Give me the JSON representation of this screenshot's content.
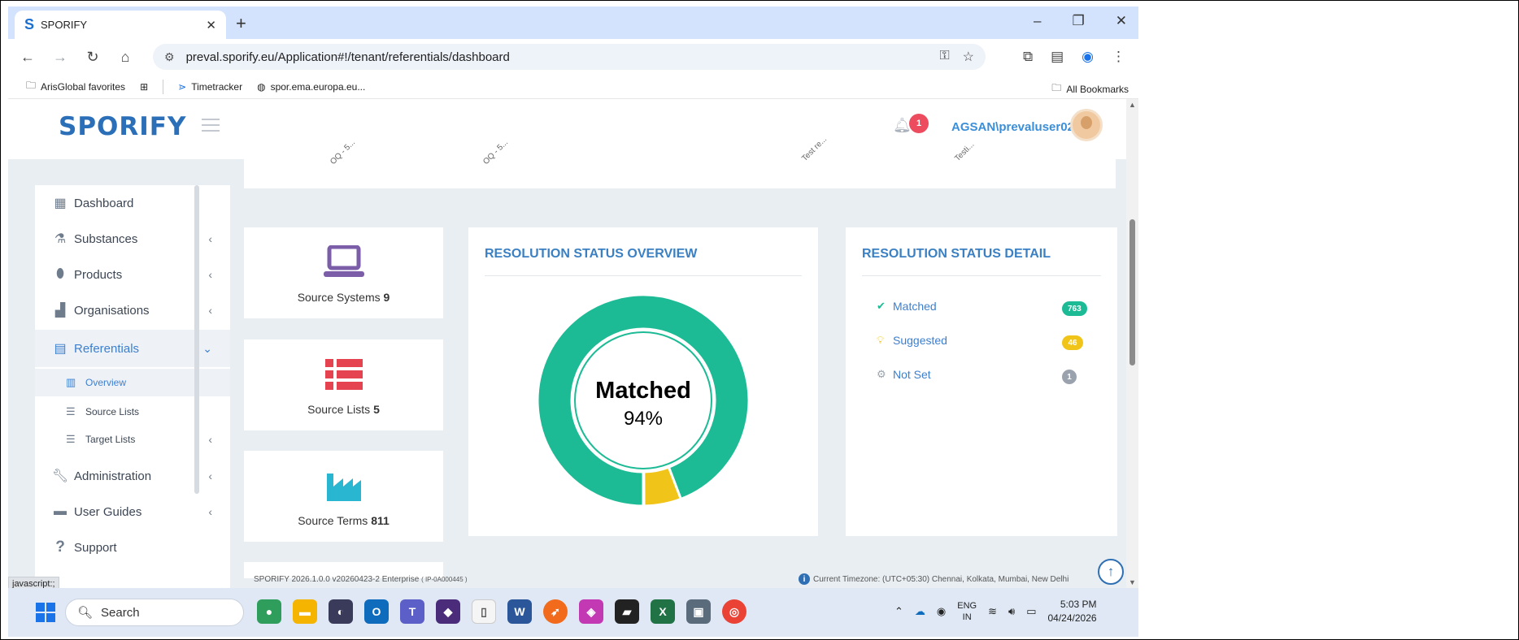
{
  "browser": {
    "tab_title": "SPORIFY",
    "tab_logo": "S",
    "url": "preval.sporify.eu/Application#!/tenant/referentials/dashboard",
    "bookmarks": [
      {
        "label": "ArisGlobal favorites",
        "icon": "folder-icon"
      },
      {
        "label": "Timetracker",
        "icon": "timetracker-icon"
      },
      {
        "label": "spor.ema.europa.eu...",
        "icon": "globe-icon"
      }
    ],
    "all_bookmarks": "All Bookmarks",
    "status_hint": "javascript:;"
  },
  "header": {
    "logo": "SPORIFY",
    "notification_count": "1",
    "user": "AGSAN\\prevaluser02"
  },
  "sidebar": {
    "items": [
      {
        "label": "Dashboard",
        "icon": "dashboard-icon",
        "chevron": ""
      },
      {
        "label": "Substances",
        "icon": "flask-icon",
        "chevron": "‹"
      },
      {
        "label": "Products",
        "icon": "pills-icon",
        "chevron": "‹"
      },
      {
        "label": "Organisations",
        "icon": "industry-icon",
        "chevron": "‹"
      },
      {
        "label": "Referentials",
        "icon": "list-alt-icon",
        "chevron": "⌄"
      },
      {
        "label": "Administration",
        "icon": "wrench-icon",
        "chevron": "‹"
      },
      {
        "label": "User Guides",
        "icon": "book-icon",
        "chevron": "‹"
      },
      {
        "label": "Support",
        "icon": "question-icon",
        "chevron": ""
      }
    ],
    "subitems": [
      {
        "label": "Overview",
        "icon": "bar-chart-icon"
      },
      {
        "label": "Source Lists",
        "icon": "list-icon"
      },
      {
        "label": "Target Lists",
        "icon": "list-icon",
        "chevron": "‹"
      }
    ]
  },
  "chart_ticks": [
    "OQ - 5...",
    "OQ - 5...",
    "Test re...",
    "Testi..."
  ],
  "stats": [
    {
      "label": "Source Systems",
      "value": "9",
      "icon": "laptop-icon",
      "color": "#7b5ea7"
    },
    {
      "label": "Source Lists",
      "value": "5",
      "icon": "list-icon",
      "color": "#e5434f"
    },
    {
      "label": "Source Terms",
      "value": "811",
      "icon": "industry-icon",
      "color": "#29b6d1"
    }
  ],
  "overview": {
    "title": "RESOLUTION STATUS OVERVIEW",
    "center_label": "Matched",
    "center_value": "94%"
  },
  "chart_data": {
    "type": "pie",
    "categories": [
      "Matched",
      "Suggested",
      "Not Set"
    ],
    "values": [
      763,
      46,
      1
    ],
    "colors": [
      "#1dbb95",
      "#f0c419",
      "#aab0b8"
    ],
    "title": ""
  },
  "detail": {
    "title": "RESOLUTION STATUS DETAIL",
    "rows": [
      {
        "label": "Matched",
        "count": "763",
        "icon": "check-circle-icon",
        "color": "#1dbb95"
      },
      {
        "label": "Suggested",
        "count": "46",
        "icon": "lightbulb-icon",
        "color": "#f0c419"
      },
      {
        "label": "Not Set",
        "count": "1",
        "icon": "cog-icon",
        "color": "#9aa3ad"
      }
    ]
  },
  "footer": {
    "version": "SPORIFY 2026.1.0.0 v20260423-2 Enterprise",
    "build": "( IP-0A000445 )",
    "timezone": "Current Timezone: (UTC+05:30) Chennai, Kolkata, Mumbai, New Delhi"
  },
  "taskbar": {
    "search": "Search",
    "lang_1": "ENG",
    "lang_2": "IN",
    "time": "5:03 PM",
    "date": "04/24/2026"
  }
}
